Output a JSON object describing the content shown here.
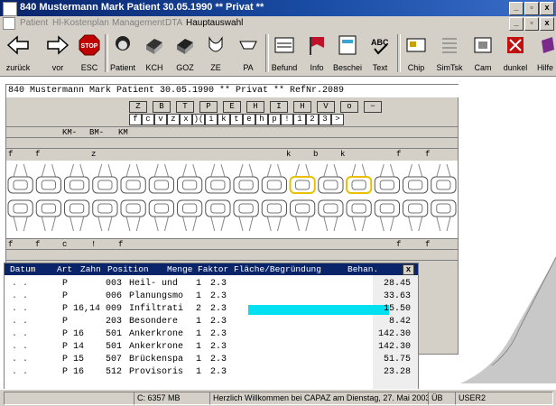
{
  "window": {
    "title": "840 Mustermann Mark Patient 30.05.1990  ** Privat **",
    "btn_min": "_",
    "btn_max": "▫",
    "btn_close": "x"
  },
  "menu": [
    "Patient",
    "Hl-Kostenplan",
    "Management",
    "DTA",
    "Hauptauswahl"
  ],
  "toolbar": [
    {
      "label": "zurück",
      "icon": "arrow-left-icon"
    },
    {
      "label": "vor",
      "icon": "arrow-right-icon"
    },
    {
      "label": "ESC",
      "icon": "stop-sign-icon"
    },
    {
      "label": "Patient",
      "icon": "patient-head-icon"
    },
    {
      "label": "KCH",
      "icon": "kch-box-icon"
    },
    {
      "label": "GOZ",
      "icon": "goz-box-icon"
    },
    {
      "label": "ZE",
      "icon": "dental-prosthesis-icon"
    },
    {
      "label": "PA",
      "icon": "pa-tool-icon"
    },
    {
      "label": "Befund",
      "icon": "befund-chart-icon"
    },
    {
      "label": "Info",
      "icon": "info-flag-icon"
    },
    {
      "label": "Beschei",
      "icon": "bescheid-doc-icon"
    },
    {
      "label": "Text",
      "icon": "text-abc-icon"
    },
    {
      "label": "Chip",
      "icon": "chip-card-icon"
    },
    {
      "label": "SimTsk",
      "icon": "simtsk-icon"
    },
    {
      "label": "Cam",
      "icon": "camera-icon"
    },
    {
      "label": "dunkel",
      "icon": "dunkel-icon"
    },
    {
      "label": "Hilfe",
      "icon": "help-book-icon"
    }
  ],
  "doc": {
    "header": "840 Mustermann Mark Patient 30.05.1990  ** Privat ** RefNr.2089",
    "row1": [
      "Z",
      "B",
      "T",
      "P",
      "E",
      "H",
      "I",
      "H",
      "V",
      "o",
      "−"
    ],
    "row2": [
      "f",
      "c",
      "v",
      "z",
      "x",
      ")(",
      "i",
      "k",
      "t",
      "e",
      "h",
      "p",
      "!",
      "1",
      "2",
      "3",
      ">"
    ],
    "labels_top": [
      "KM-",
      "BM-",
      "KM"
    ],
    "marks_upper": [
      "f",
      "f",
      "z",
      "k",
      "b",
      "k",
      "f",
      "f"
    ],
    "marks_lower": [
      "f",
      "f",
      "c",
      "!",
      "f",
      "f",
      "f"
    ]
  },
  "list": {
    "headers": [
      "Datum",
      "Art",
      "Zahn",
      "Position",
      "Menge",
      "Faktor",
      "Fläche/Begründung",
      "Behan.",
      "x"
    ],
    "rows": [
      {
        "date": ". .",
        "art": "P",
        "zahn": "",
        "pos": "003",
        "desc": "Heil- und",
        "menge": "1",
        "faktor": "2.3",
        "amount": "28.45"
      },
      {
        "date": ". .",
        "art": "P",
        "zahn": "",
        "pos": "006",
        "desc": "Planungsmo",
        "menge": "1",
        "faktor": "2.3",
        "amount": "33.63"
      },
      {
        "date": ". .",
        "art": "P",
        "zahn": "16,14",
        "pos": "009",
        "desc": "Infiltrati",
        "menge": "2",
        "faktor": "2.3",
        "amount": "15.50"
      },
      {
        "date": ". .",
        "art": "P",
        "zahn": "",
        "pos": "203",
        "desc": "Besondere",
        "menge": "1",
        "faktor": "2.3",
        "amount": "8.42"
      },
      {
        "date": ". .",
        "art": "P",
        "zahn": "16",
        "pos": "501",
        "desc": "Ankerkrone",
        "menge": "1",
        "faktor": "2.3",
        "amount": "142.30"
      },
      {
        "date": ". .",
        "art": "P",
        "zahn": "14",
        "pos": "501",
        "desc": "Ankerkrone",
        "menge": "1",
        "faktor": "2.3",
        "amount": "142.30"
      },
      {
        "date": ". .",
        "art": "P",
        "zahn": "15",
        "pos": "507",
        "desc": "Brückenspa",
        "menge": "1",
        "faktor": "2.3",
        "amount": "51.75"
      },
      {
        "date": ". .",
        "art": "P",
        "zahn": "16",
        "pos": "512",
        "desc": "Provisoris",
        "menge": "1",
        "faktor": "2.3",
        "amount": "23.28"
      }
    ]
  },
  "status": {
    "disk": "C: 6357 MB",
    "message": "Herzlich Willkommen bei CAPAZ am  Dienstag, 27. Mai 2003",
    "mode": "ÜB",
    "user": "USER2"
  },
  "colors": {
    "highlight": "#00e0f0",
    "title_bg": "#0a246a",
    "selection_yellow": "#ffd700"
  }
}
